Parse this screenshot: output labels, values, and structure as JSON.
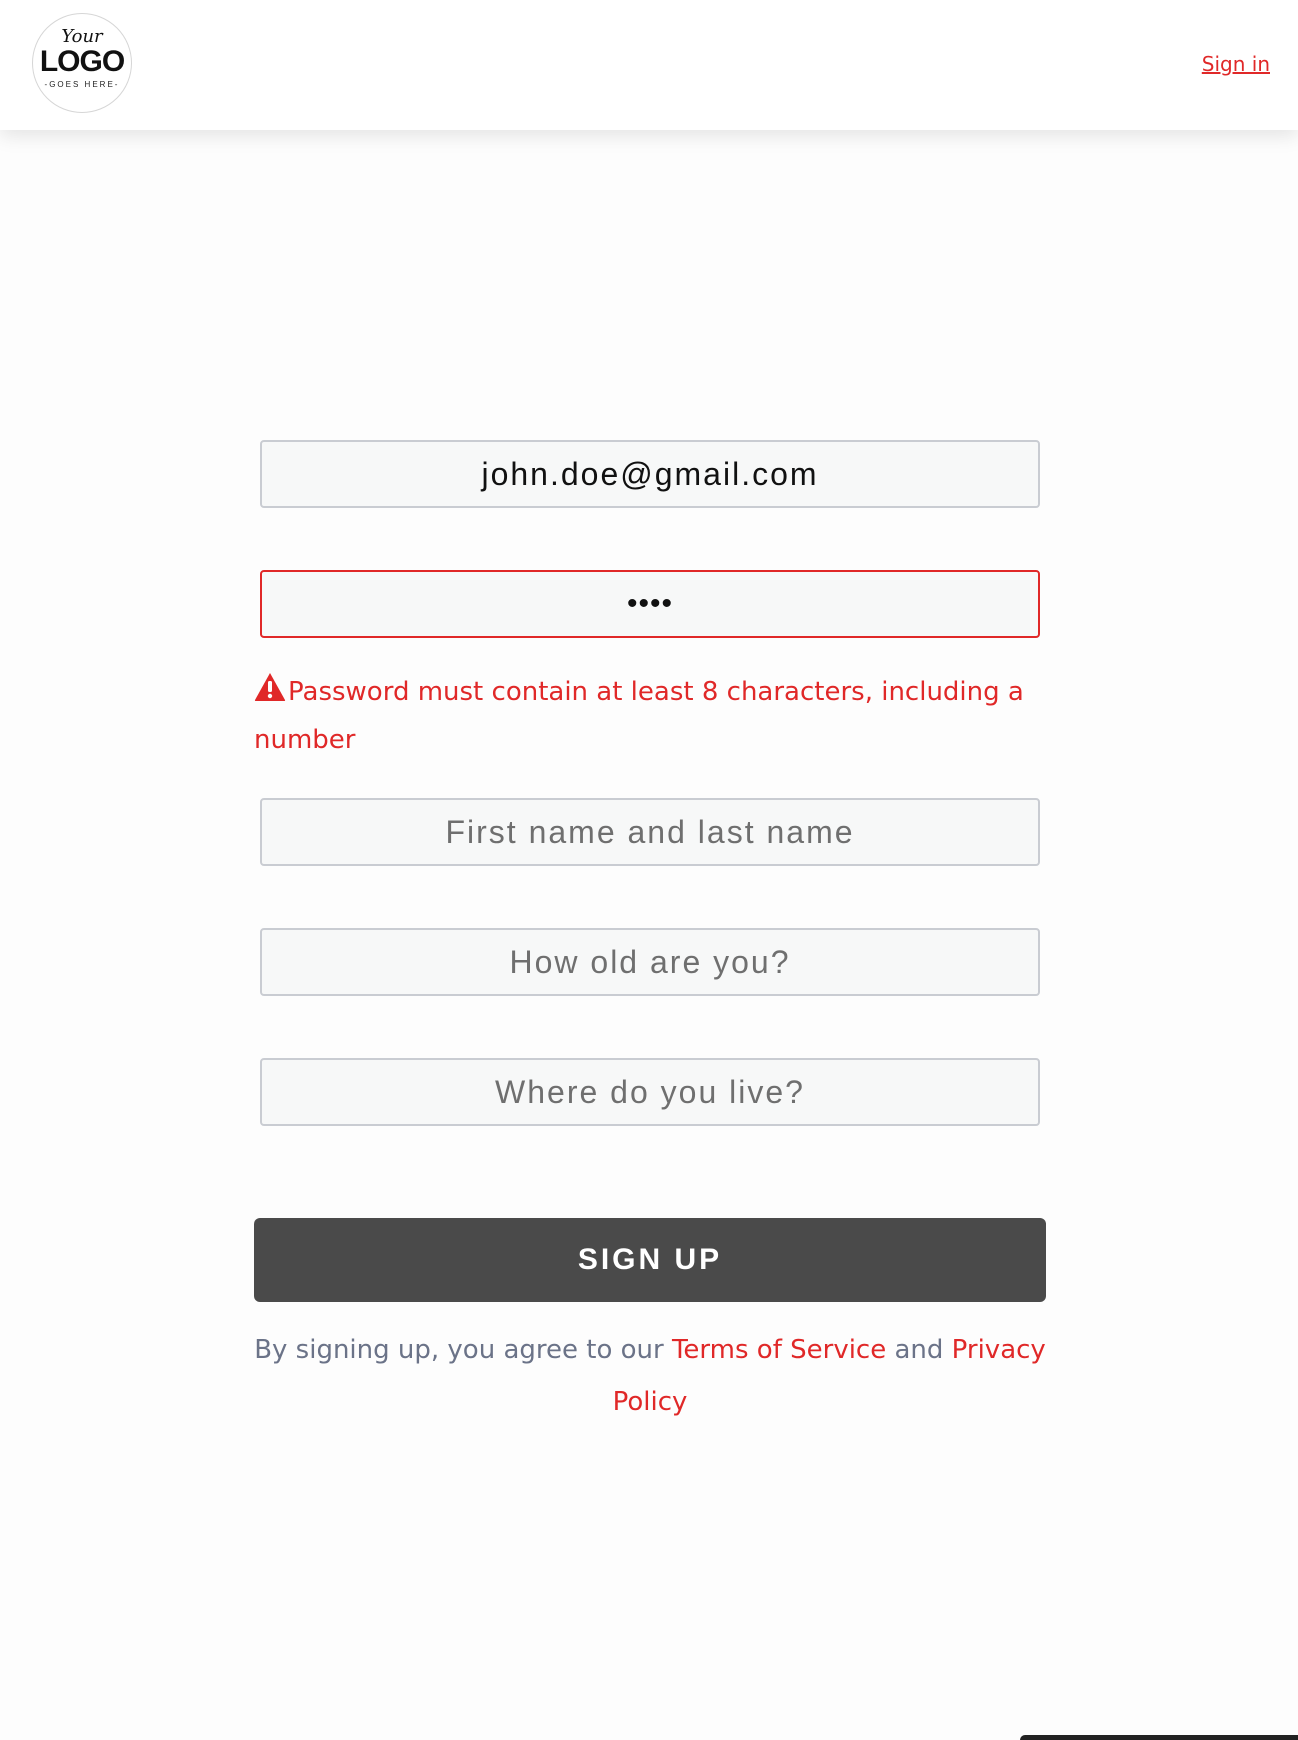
{
  "header": {
    "logo": {
      "top_text": "Your",
      "main_text": "LOGO",
      "sub_text": "-GOES HERE-"
    },
    "signin_label": "Sign in"
  },
  "form": {
    "email": {
      "value": "john.doe@gmail.com"
    },
    "password": {
      "value_masked": "••••",
      "state": "error"
    },
    "password_error": "Password must contain at least 8 characters, including a number",
    "name": {
      "placeholder": "First name and last name"
    },
    "age": {
      "placeholder": "How old are you?"
    },
    "location": {
      "placeholder": "Where do you live?"
    },
    "submit_label": "SIGN UP"
  },
  "terms": {
    "prefix": "By signing up, you agree to our ",
    "terms_link": "Terms of Service",
    "middle": " and ",
    "privacy_link": "Privacy Policy"
  },
  "colors": {
    "accent": "#e02828",
    "button_bg": "#4a4a4a",
    "muted_text": "#6b7388",
    "field_bg": "#f7f8f8",
    "field_border": "#c9ccd2"
  },
  "icons": {
    "error": "warning-triangle-icon"
  }
}
